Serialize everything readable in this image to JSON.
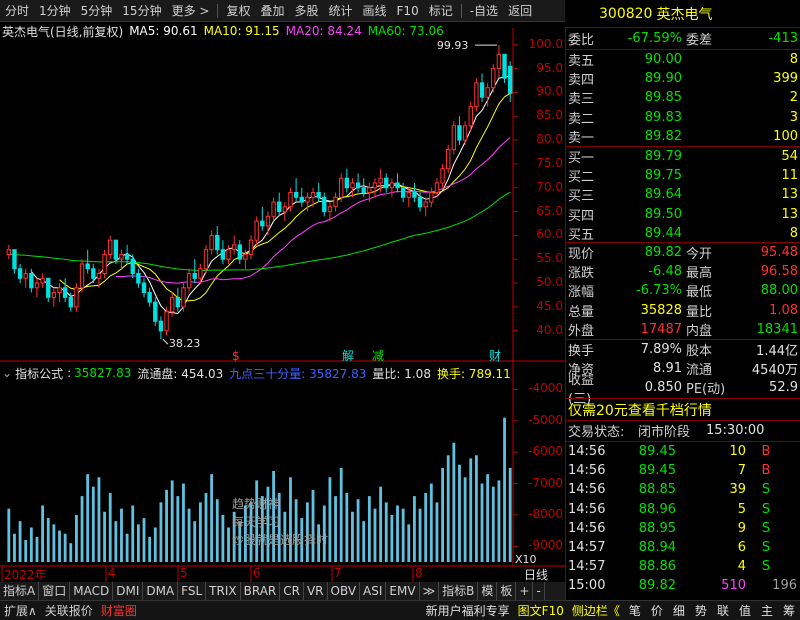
{
  "toolbar": {
    "items": [
      "分时",
      "1分钟",
      "5分钟",
      "15分钟",
      "更多 >",
      "复权",
      "叠加",
      "多股",
      "统计",
      "画线",
      "F10",
      "标记",
      "-自选",
      "返回"
    ]
  },
  "stock": {
    "code": "300820",
    "name": "英杰电气"
  },
  "main_chart": {
    "title": "英杰电气(日线,前复权)",
    "ma5_label": "MA5: 90.61",
    "ma10_label": "MA10: 91.15",
    "ma20_label": "MA20: 84.24",
    "ma60_label": "MA60: 73.06",
    "high_label": "99.93",
    "low_label": "38.23",
    "yticks": [
      "100.0",
      "95.0",
      "90.0",
      "85.0",
      "80.0",
      "75.0",
      "70.0",
      "65.0",
      "60.0",
      "55.0",
      "50.0",
      "45.0",
      "40.0"
    ],
    "markers": [
      {
        "text": "$",
        "color": "#ff3030"
      },
      {
        "text": "解",
        "color": "#00e0e0"
      },
      {
        "text": "减",
        "color": "#00e000"
      },
      {
        "text": "财",
        "color": "#00e0e0"
      }
    ]
  },
  "indicator": {
    "title": "指标公式",
    "v1_label": "35827.83",
    "ltp_label": "流通盘: 454.03",
    "jd_label": "九点三十分量: 35827.83",
    "lb_label": "量比: 1.08",
    "hs_label": "换手: 789.11",
    "yticks": [
      "-4000",
      "-5000",
      "-6000",
      "-7000",
      "-8000",
      "-9000"
    ],
    "multiplier": "X10",
    "watermark": [
      "趋势财神",
      "每天学习",
      "炒股就是选股择时"
    ]
  },
  "xaxis": {
    "labels": [
      "2022年",
      "4",
      "5",
      "6",
      "7",
      "8"
    ],
    "right": "日线"
  },
  "order_book": {
    "weibi_label": "委比",
    "weibi": "-67.59%",
    "weicha_label": "委差",
    "weicha": "-413",
    "asks": [
      {
        "label": "卖五",
        "price": "90.00",
        "vol": "8"
      },
      {
        "label": "卖四",
        "price": "89.90",
        "vol": "399"
      },
      {
        "label": "卖三",
        "price": "89.85",
        "vol": "2"
      },
      {
        "label": "卖二",
        "price": "89.83",
        "vol": "3"
      },
      {
        "label": "卖一",
        "price": "89.82",
        "vol": "100"
      }
    ],
    "bids": [
      {
        "label": "买一",
        "price": "89.79",
        "vol": "54"
      },
      {
        "label": "买二",
        "price": "89.75",
        "vol": "11"
      },
      {
        "label": "买三",
        "price": "89.64",
        "vol": "13"
      },
      {
        "label": "买四",
        "price": "89.50",
        "vol": "13"
      },
      {
        "label": "买五",
        "price": "89.44",
        "vol": "8"
      }
    ]
  },
  "quote": {
    "rows": [
      {
        "l1": "现价",
        "v1": "89.82",
        "c1": "green",
        "l2": "今开",
        "v2": "95.48",
        "c2": "red"
      },
      {
        "l1": "涨跌",
        "v1": "-6.48",
        "c1": "green",
        "l2": "最高",
        "v2": "96.58",
        "c2": "red"
      },
      {
        "l1": "涨幅",
        "v1": "-6.73%",
        "c1": "green",
        "l2": "最低",
        "v2": "88.00",
        "c2": "green"
      },
      {
        "l1": "总量",
        "v1": "35828",
        "c1": "yellow",
        "l2": "量比",
        "v2": "1.08",
        "c2": "red"
      },
      {
        "l1": "外盘",
        "v1": "17487",
        "c1": "red",
        "l2": "内盘",
        "v2": "18341",
        "c2": "green"
      }
    ],
    "rows2": [
      {
        "l1": "换手",
        "v1": "7.89%",
        "l2": "股本",
        "v2": "1.44亿"
      },
      {
        "l1": "净资",
        "v1": "8.91",
        "l2": "流通",
        "v2": "4540万"
      },
      {
        "l1": "收益(三)",
        "v1": "0.850",
        "l2": "PE(动)",
        "v2": "52.9"
      }
    ]
  },
  "promo": "仅需20元查看千档行情",
  "trade_status": {
    "label": "交易状态:",
    "value": "闭市阶段",
    "time": "15:30:00"
  },
  "ticks": [
    {
      "t": "14:56",
      "p": "89.45",
      "v": "10",
      "bs": "B"
    },
    {
      "t": "14:56",
      "p": "89.45",
      "v": "7",
      "bs": "B"
    },
    {
      "t": "14:56",
      "p": "88.85",
      "v": "39",
      "bs": "S"
    },
    {
      "t": "14:56",
      "p": "88.96",
      "v": "5",
      "bs": "S"
    },
    {
      "t": "14:56",
      "p": "88.95",
      "v": "9",
      "bs": "S"
    },
    {
      "t": "14:57",
      "p": "88.94",
      "v": "6",
      "bs": "S"
    },
    {
      "t": "14:57",
      "p": "88.86",
      "v": "4",
      "bs": "S"
    },
    {
      "t": "15:00",
      "p": "89.82",
      "v": "510",
      "bs": "",
      "extra": "196"
    }
  ],
  "bottom_tabs": [
    "指标A",
    "窗口",
    "MACD",
    "DMI",
    "DMA",
    "FSL",
    "TRIX",
    "BRAR",
    "CR",
    "VR",
    "OBV",
    "ASI",
    "EMV",
    "≫",
    "指标B",
    "模",
    "板",
    "+",
    "-"
  ],
  "status": {
    "items": [
      "扩展∧",
      "关联报价",
      "财富圈"
    ],
    "right": [
      "新用户福利专享",
      "图文F10",
      "侧边栏《"
    ],
    "side": [
      "笔",
      "价",
      "细",
      "势",
      "联",
      "值",
      "主",
      "筹"
    ]
  },
  "colors": {
    "up": "#ff3030",
    "down": "#00e0e0",
    "ma5": "#ffffff",
    "ma10": "#ffff00",
    "ma20": "#ff40ff",
    "ma60": "#00e000",
    "axis": "#c00000"
  },
  "chart_data": {
    "type": "candlestick",
    "ylim": [
      37,
      101
    ],
    "candles": [
      [
        56,
        58,
        55,
        57
      ],
      [
        57,
        57,
        52,
        53
      ],
      [
        53,
        54,
        50,
        51
      ],
      [
        51,
        53,
        49,
        52
      ],
      [
        52,
        53,
        48,
        49
      ],
      [
        49,
        51,
        47,
        50
      ],
      [
        50,
        52,
        49,
        51
      ],
      [
        51,
        51,
        46,
        47
      ],
      [
        47,
        49,
        45,
        48
      ],
      [
        48,
        50,
        46,
        49
      ],
      [
        49,
        51,
        46,
        47
      ],
      [
        47,
        48,
        44,
        45
      ],
      [
        45,
        50,
        44,
        49
      ],
      [
        49,
        55,
        48,
        54
      ],
      [
        54,
        57,
        52,
        53
      ],
      [
        53,
        54,
        50,
        51
      ],
      [
        51,
        53,
        49,
        52
      ],
      [
        52,
        57,
        51,
        56
      ],
      [
        56,
        60,
        55,
        59
      ],
      [
        59,
        59,
        54,
        55
      ],
      [
        55,
        57,
        53,
        56
      ],
      [
        56,
        58,
        54,
        55
      ],
      [
        55,
        56,
        51,
        52
      ],
      [
        52,
        53,
        49,
        50
      ],
      [
        50,
        51,
        47,
        48
      ],
      [
        48,
        49,
        45,
        46
      ],
      [
        46,
        47,
        41,
        42
      ],
      [
        42,
        43,
        38.23,
        40
      ],
      [
        40,
        45,
        39,
        44
      ],
      [
        44,
        48,
        43,
        47
      ],
      [
        47,
        49,
        44,
        45
      ],
      [
        45,
        50,
        44,
        49
      ],
      [
        49,
        53,
        48,
        52
      ],
      [
        52,
        55,
        50,
        51
      ],
      [
        51,
        54,
        50,
        53
      ],
      [
        53,
        58,
        52,
        57
      ],
      [
        57,
        61,
        56,
        60
      ],
      [
        60,
        62,
        56,
        57
      ],
      [
        57,
        59,
        54,
        55
      ],
      [
        55,
        58,
        54,
        57
      ],
      [
        57,
        60,
        56,
        58
      ],
      [
        58,
        59,
        54,
        55
      ],
      [
        55,
        57,
        53,
        56
      ],
      [
        56,
        60,
        55,
        59
      ],
      [
        59,
        64,
        58,
        63
      ],
      [
        63,
        66,
        61,
        62
      ],
      [
        62,
        65,
        60,
        64
      ],
      [
        64,
        68,
        63,
        67
      ],
      [
        67,
        69,
        64,
        65
      ],
      [
        65,
        67,
        63,
        66
      ],
      [
        66,
        70,
        65,
        69
      ],
      [
        69,
        72,
        67,
        68
      ],
      [
        68,
        70,
        66,
        67
      ],
      [
        67,
        69,
        65,
        68
      ],
      [
        68,
        70,
        66,
        69
      ],
      [
        69,
        71,
        67,
        68
      ],
      [
        68,
        69,
        64,
        65
      ],
      [
        65,
        67,
        63,
        66
      ],
      [
        66,
        69,
        65,
        68
      ],
      [
        68,
        73,
        67,
        72
      ],
      [
        72,
        74,
        69,
        70
      ],
      [
        70,
        72,
        68,
        71
      ],
      [
        71,
        73,
        69,
        70
      ],
      [
        70,
        72,
        68,
        69
      ],
      [
        69,
        71,
        67,
        70
      ],
      [
        70,
        72,
        68,
        71
      ],
      [
        71,
        74,
        69,
        72
      ],
      [
        72,
        73,
        69,
        70
      ],
      [
        70,
        72,
        68,
        71
      ],
      [
        71,
        73,
        69,
        70
      ],
      [
        70,
        71,
        67,
        68
      ],
      [
        68,
        70,
        66,
        69
      ],
      [
        69,
        71,
        67,
        68
      ],
      [
        68,
        69,
        65,
        66
      ],
      [
        66,
        68,
        64,
        67
      ],
      [
        67,
        70,
        66,
        69
      ],
      [
        69,
        72,
        68,
        71
      ],
      [
        71,
        75,
        70,
        74
      ],
      [
        74,
        79,
        73,
        78
      ],
      [
        78,
        84,
        77,
        83
      ],
      [
        83,
        85,
        79,
        80
      ],
      [
        80,
        84,
        79,
        83
      ],
      [
        83,
        88,
        82,
        87
      ],
      [
        87,
        93,
        86,
        92
      ],
      [
        92,
        94,
        88,
        89
      ],
      [
        89,
        92,
        87,
        91
      ],
      [
        91,
        96,
        90,
        95
      ],
      [
        95,
        99.93,
        93,
        98
      ],
      [
        98,
        98,
        92,
        93
      ],
      [
        95.48,
        96.58,
        88,
        89.82
      ]
    ],
    "volumes": [
      -7800,
      -8600,
      -8200,
      -8800,
      -8400,
      -8700,
      -7700,
      -8100,
      -8300,
      -8500,
      -8600,
      -8900,
      -8000,
      -7400,
      -6700,
      -7100,
      -6800,
      -7900,
      -7300,
      -8200,
      -7800,
      -8600,
      -7700,
      -8300,
      -8100,
      -8700,
      -8400,
      -7600,
      -7200,
      -6900,
      -7400,
      -7000,
      -7800,
      -8200,
      -7600,
      -7300,
      -6700,
      -7500,
      -8000,
      -8400,
      -7900,
      -8200,
      -7700,
      -7600,
      -6900,
      -7400,
      -7100,
      -6600,
      -7300,
      -7900,
      -6800,
      -7500,
      -8100,
      -7600,
      -7200,
      -8300,
      -7700,
      -6800,
      -7400,
      -6500,
      -7300,
      -7900,
      -7500,
      -8200,
      -7400,
      -7800,
      -7100,
      -7600,
      -8000,
      -7700,
      -7800,
      -8300,
      -7400,
      -7800,
      -7300,
      -7000,
      -7600,
      -6500,
      -6100,
      -5700,
      -6400,
      -6800,
      -6200,
      -6100,
      -7000,
      -6700,
      -7100,
      -6900,
      -4900,
      -6500
    ]
  }
}
